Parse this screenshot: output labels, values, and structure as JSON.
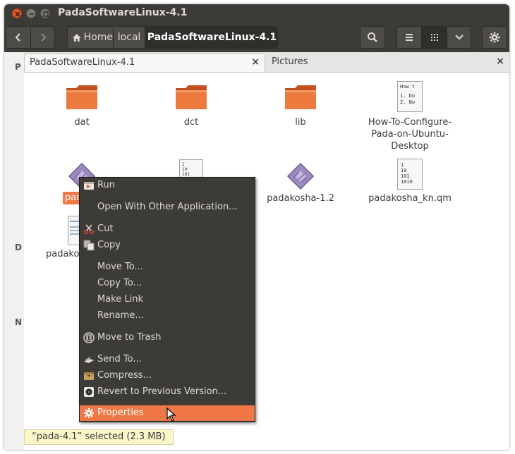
{
  "window": {
    "title": "PadaSoftwareLinux-4.1"
  },
  "toolbar": {
    "path": [
      "Home",
      "local",
      "PadaSoftwareLinux-4.1"
    ]
  },
  "sidebar": {
    "letters": [
      "P",
      "D",
      "N"
    ]
  },
  "tabs": [
    {
      "label": "PadaSoftwareLinux-4.1",
      "close": "×"
    },
    {
      "label": "Pictures",
      "close": "×"
    }
  ],
  "files": [
    {
      "name": "dat",
      "type": "folder"
    },
    {
      "name": "dct",
      "type": "folder"
    },
    {
      "name": "lib",
      "type": "folder"
    },
    {
      "name": "How-To-Configure-Pada-on-Ubuntu-Desktop",
      "type": "text",
      "preview": [
        "How t",
        "1. Do",
        "2. No"
      ]
    },
    {
      "name": "pada-4.1",
      "type": "executable",
      "selected": true
    },
    {
      "name": "",
      "type": "binary"
    },
    {
      "name": "padakosha-1.2",
      "type": "executable"
    },
    {
      "name": "padakosha_kn.qm",
      "type": "binary",
      "preview": [
        "1",
        "10",
        "101",
        "1010"
      ]
    },
    {
      "name": "padakos",
      "type": "document"
    }
  ],
  "selected_label_visible": "pad",
  "context_menu": {
    "items": [
      {
        "label": "Run",
        "icon": "run-icon"
      },
      {
        "label": "Open With Other Application...",
        "icon": ""
      },
      {
        "label": "Cut",
        "icon": "scissors-icon"
      },
      {
        "label": "Copy",
        "icon": "copy-icon"
      },
      {
        "label": "Move To...",
        "icon": ""
      },
      {
        "label": "Copy To...",
        "icon": ""
      },
      {
        "label": "Make Link",
        "icon": ""
      },
      {
        "label": "Rename...",
        "icon": ""
      },
      {
        "label": "Move to Trash",
        "icon": "trash-icon"
      },
      {
        "label": "Send To...",
        "icon": "send-icon"
      },
      {
        "label": "Compress...",
        "icon": "archive-icon"
      },
      {
        "label": "Revert to Previous Version...",
        "icon": "revert-icon"
      },
      {
        "label": "Properties",
        "icon": "gear-icon",
        "highlighted": true
      }
    ]
  },
  "statusbar": {
    "text": "“pada-4.1” selected  (2.3 MB)"
  },
  "colors": {
    "accent": "#f07746",
    "titlebar": "#3c3b37",
    "folder": "#e86a2e"
  }
}
